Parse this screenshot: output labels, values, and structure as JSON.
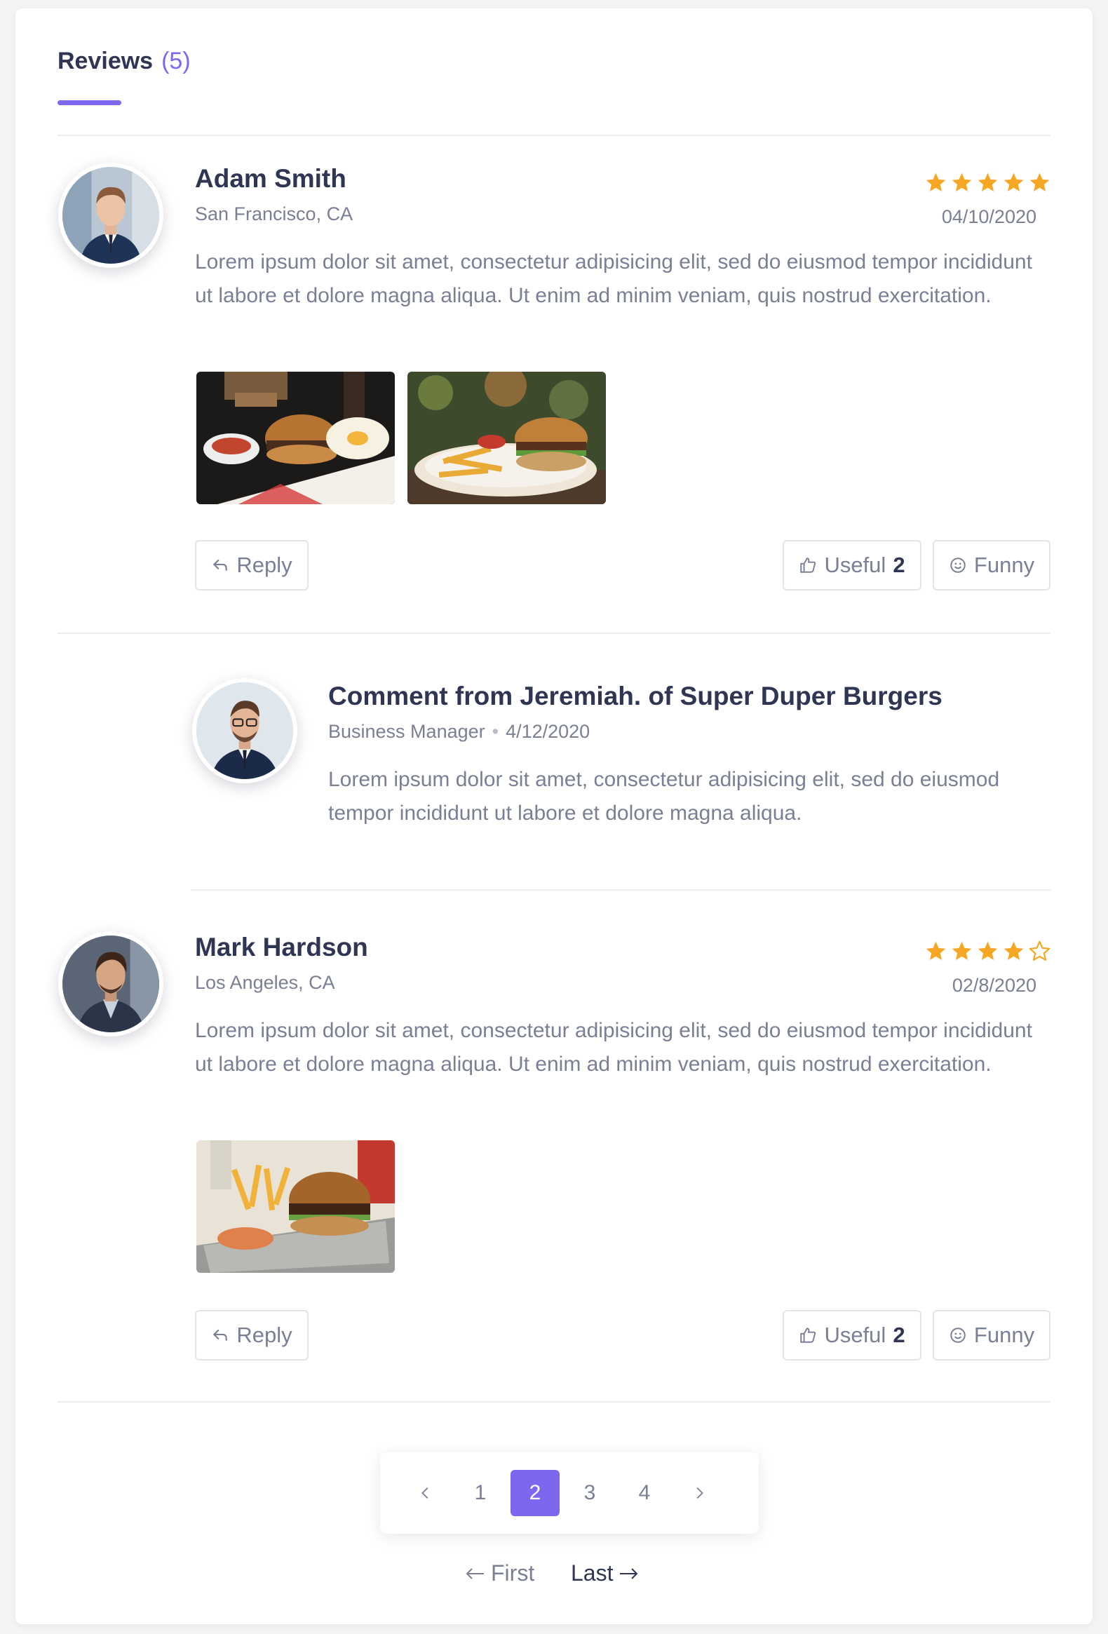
{
  "header": {
    "title": "Reviews",
    "count": "(5)"
  },
  "colors": {
    "accent": "#7b68ee",
    "star": "#f5a623",
    "text": "#2f3552",
    "muted": "#7b7f95"
  },
  "reviews": [
    {
      "name": "Adam Smith",
      "location": "San Francisco, CA",
      "date": "04/10/2020",
      "rating": 5,
      "max_rating": 5,
      "text": "Lorem ipsum dolor sit amet, consectetur adipisicing elit, sed do eiusmod tempor incididunt ut labore et dolore magna aliqua. Ut enim ad minim veniam, quis nostrud exercitation.",
      "reply_label": "Reply",
      "useful_label": "Useful",
      "useful_count": "2",
      "funny_label": "Funny"
    },
    {
      "name": "Mark Hardson",
      "location": "Los Angeles, CA",
      "date": "02/8/2020",
      "rating": 4,
      "max_rating": 5,
      "text": "Lorem ipsum dolor sit amet, consectetur adipisicing elit, sed do eiusmod tempor incididunt ut labore et dolore magna aliqua. Ut enim ad minim veniam, quis nostrud exercitation.",
      "reply_label": "Reply",
      "useful_label": "Useful",
      "useful_count": "2",
      "funny_label": "Funny"
    }
  ],
  "owner_reply": {
    "title": "Comment from Jeremiah. of Super Duper Burgers",
    "role": "Business Manager",
    "date": "4/12/2020",
    "text": "Lorem ipsum dolor sit amet, consectetur adipisicing elit, sed do eiusmod tempor incididunt ut labore et dolore magna aliqua."
  },
  "pagination": {
    "pages": [
      "1",
      "2",
      "3",
      "4"
    ],
    "current": "2",
    "first_label": "First",
    "last_label": "Last"
  }
}
